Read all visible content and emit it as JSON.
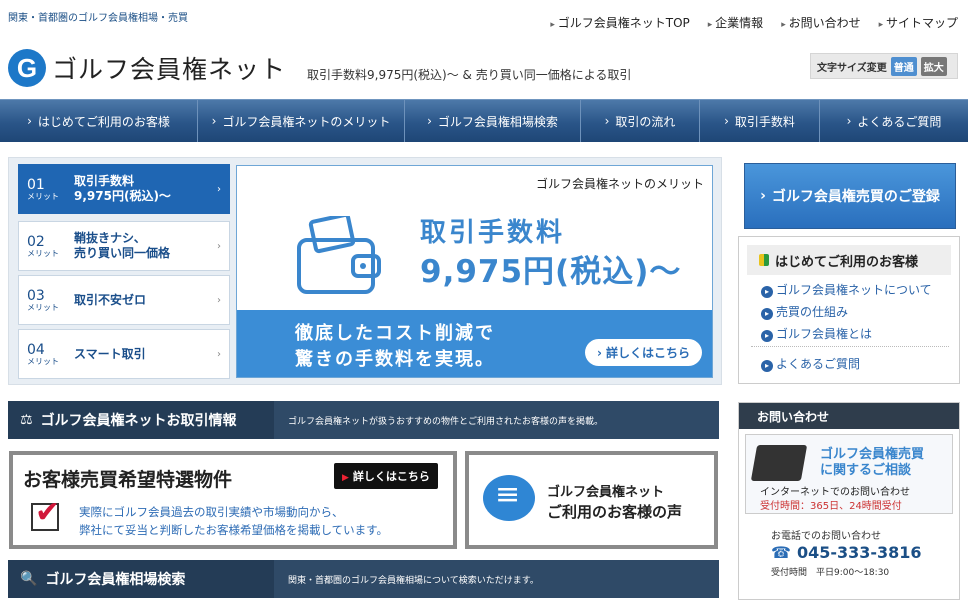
{
  "header": {
    "tagline": "関東・首都圏のゴルフ会員権相場・売買",
    "top_links": [
      "ゴルフ会員権ネットTOP",
      "企業情報",
      "お問い合わせ",
      "サイトマップ"
    ],
    "logo_mark": "G",
    "logo_text": "ゴルフ会員権ネット",
    "slogan": "取引手数料9,975円(税込)～ & 売り買い同一価格による取引",
    "font_size_label": "文字サイズ変更",
    "font_size_normal": "普通",
    "font_size_large": "拡大"
  },
  "nav": [
    "はじめてご利用のお客様",
    "ゴルフ会員権ネットのメリット",
    "ゴルフ会員権相場検索",
    "取引の流れ",
    "取引手数料",
    "よくあるご質問"
  ],
  "features": [
    {
      "num": "01",
      "sub": "メリット",
      "label": "取引手数料\n9,975円(税込)～",
      "active": true
    },
    {
      "num": "02",
      "sub": "メリット",
      "label": "鞘抜きナシ、\n売り買い同一価格",
      "active": false
    },
    {
      "num": "03",
      "sub": "メリット",
      "label": "取引不安ゼロ",
      "active": false
    },
    {
      "num": "04",
      "sub": "メリット",
      "label": "スマート取引",
      "active": false
    }
  ],
  "banner": {
    "title": "ゴルフ会員権ネットのメリット",
    "line1": "取引手数料",
    "line2": "9,975円(税込)～",
    "bottom1": "徹底したコスト削減で",
    "bottom2": "驚きの手数料を実現。",
    "more": "詳しくはこちら"
  },
  "section1": {
    "head": "ゴルフ会員権ネットお取引情報",
    "desc": "ゴルフ会員権ネットが扱うおすすめの物件とご利用されたお客様の声を掲載。"
  },
  "card1": {
    "title": "お客様売買希望特選物件",
    "button": "詳しくはこちら",
    "desc1": "実際にゴルフ会員過去の取引実績や市場動向から、",
    "desc2": "弊社にて妥当と判断したお客様希望価格を掲載しています。"
  },
  "card2": {
    "line1": "ゴルフ会員権ネット",
    "line2": "ご利用のお客様の声"
  },
  "section2": {
    "head": "ゴルフ会員権相場検索",
    "desc": "関東・首都圏のゴルフ会員権相場について検索いただけます。"
  },
  "sidebar": {
    "register": "ゴルフ会員権売買のご登録",
    "first_head": "はじめてご利用のお客様",
    "links": [
      "ゴルフ会員権ネットについて",
      "売買の仕組み",
      "ゴルフ会員権とは",
      "よくあるご質問"
    ],
    "contact_head": "お問い合わせ",
    "contact_box1": "ゴルフ会員権売買",
    "contact_box2": "に関するご相談",
    "contact_box3": "インターネットでのお問い合わせ",
    "contact_box4": "受付時間：365日、24時間受付",
    "phone_label": "お電話でのお問い合わせ",
    "phone": "045-333-3816",
    "hours": "受付時間　平日9:00～18:30"
  }
}
